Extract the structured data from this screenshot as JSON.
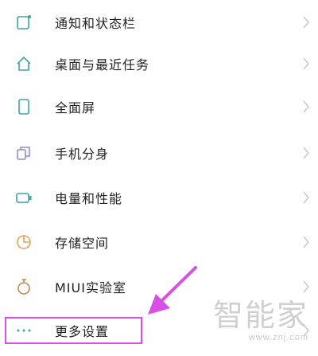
{
  "settings": {
    "items": [
      {
        "label": "通知和状态栏",
        "icon": "notification-bar-icon"
      },
      {
        "label": "桌面与最近任务",
        "icon": "home-icon"
      },
      {
        "label": "全面屏",
        "icon": "phone-icon"
      },
      {
        "label": "手机分身",
        "icon": "clone-icon"
      },
      {
        "label": "电量和性能",
        "icon": "battery-icon"
      },
      {
        "label": "存储空间",
        "icon": "storage-pie-icon"
      },
      {
        "label": "MIUI实验室",
        "icon": "lab-flask-icon"
      },
      {
        "label": "更多设置",
        "icon": "more-dots-icon"
      }
    ]
  },
  "watermark": {
    "brand": "智能家",
    "url": "www.znj.com"
  },
  "colors": {
    "icon_teal": "#3aa7a3",
    "icon_lilac": "#8b8bd8",
    "icon_orange": "#e0a35a",
    "icon_brown": "#c68a52",
    "highlight": "#d84fe6",
    "chevron": "#c7c7c7"
  }
}
